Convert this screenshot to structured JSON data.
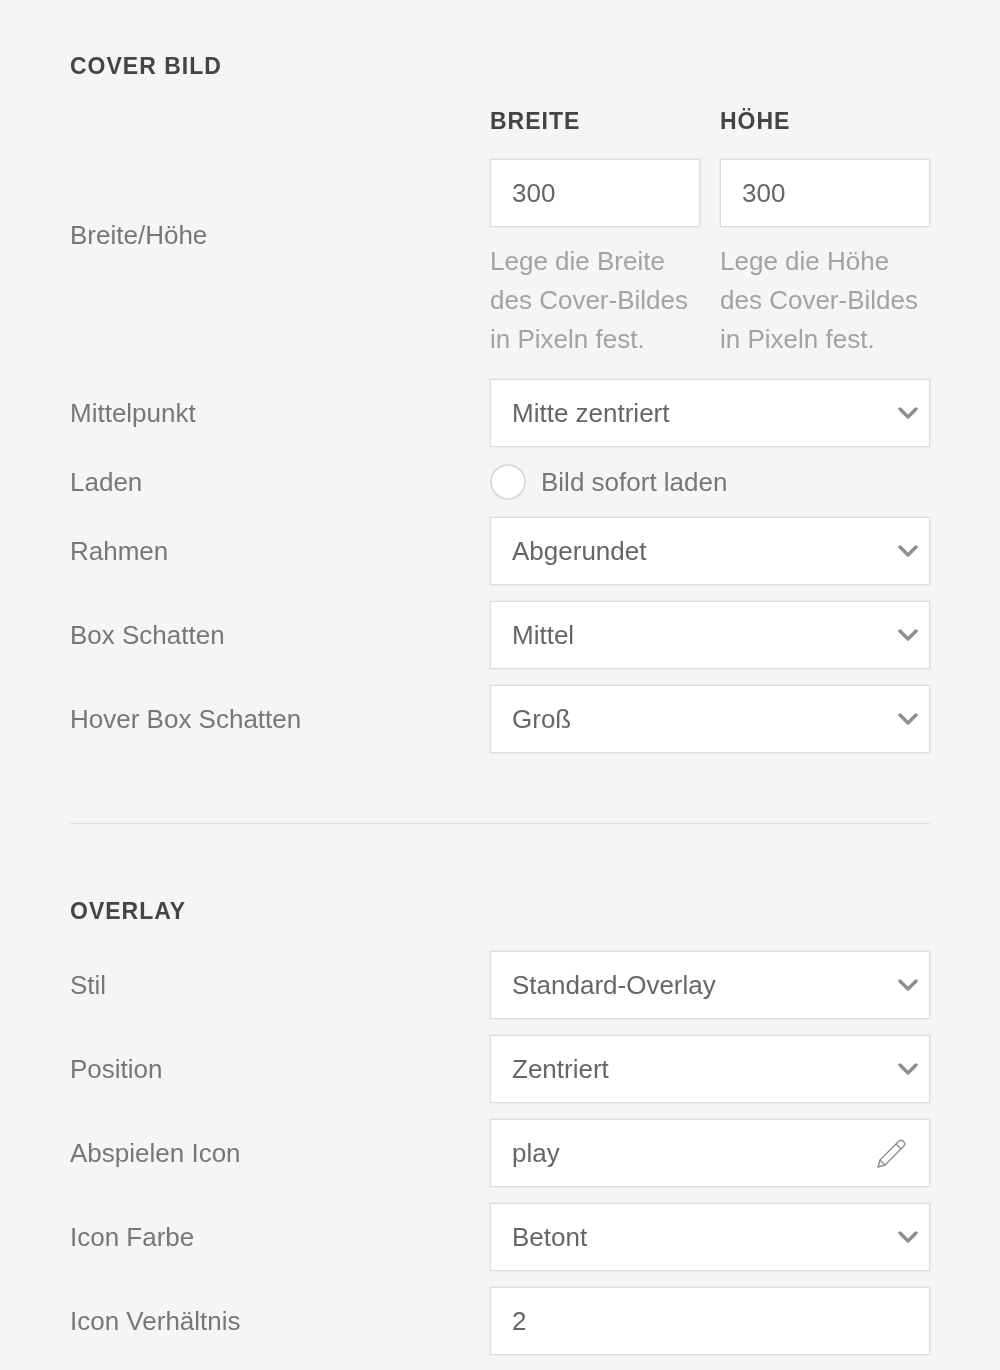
{
  "sections": [
    {
      "heading": "COVER BILD",
      "rows": [
        {
          "kind": "dimensions",
          "label": "Breite/Höhe",
          "columns": [
            {
              "heading": "BREITE",
              "value": "300",
              "help": "Lege die Breite des Cover-Bildes in Pixeln fest."
            },
            {
              "heading": "HÖHE",
              "value": "300",
              "help": "Lege die Höhe des Cover-Bildes in Pixeln fest."
            }
          ]
        },
        {
          "kind": "select",
          "label": "Mittelpunkt",
          "value": "Mitte zentriert"
        },
        {
          "kind": "radio",
          "label": "Laden",
          "option": "Bild sofort laden",
          "checked": false
        },
        {
          "kind": "select",
          "label": "Rahmen",
          "value": "Abgerundet"
        },
        {
          "kind": "select",
          "label": "Box Schatten",
          "value": "Mittel"
        },
        {
          "kind": "select",
          "label": "Hover Box Schatten",
          "value": "Groß"
        }
      ]
    },
    {
      "heading": "OVERLAY",
      "rows": [
        {
          "kind": "select",
          "label": "Stil",
          "value": "Standard-Overlay"
        },
        {
          "kind": "select",
          "label": "Position",
          "value": "Zentriert"
        },
        {
          "kind": "icon_picker",
          "label": "Abspielen Icon",
          "value": "play"
        },
        {
          "kind": "select",
          "label": "Icon Farbe",
          "value": "Betont"
        },
        {
          "kind": "text",
          "label": "Icon Verhältnis",
          "value": "2"
        }
      ]
    }
  ]
}
